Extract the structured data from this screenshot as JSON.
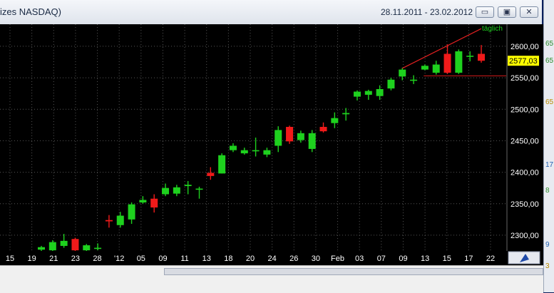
{
  "window": {
    "title": "izes NASDAQ)",
    "date_range": "28.11.2011 - 23.02.2012",
    "buttons": {
      "minimize": "▭",
      "restore": "▣",
      "close": "✕"
    }
  },
  "chart": {
    "interval_label": "täglich",
    "current_price_label": "2577,03",
    "colors": {
      "up": "#1ed11e",
      "down": "#f01a1a",
      "background": "#000000",
      "grid": "#555555",
      "text": "#ffffff",
      "price_tag": "#ffff00"
    },
    "x_tick_labels": [
      "15",
      "19",
      "21",
      "23",
      "28",
      "'12",
      "05",
      "09",
      "11",
      "13",
      "18",
      "20",
      "24",
      "26",
      "30",
      "Feb",
      "03",
      "07",
      "09",
      "13",
      "15",
      "17",
      "22"
    ],
    "y_tick_labels": [
      "2300,00",
      "2350,00",
      "2400,00",
      "2450,00",
      "2500,00",
      "2550,00",
      "2600,00"
    ]
  },
  "right_panel": {
    "labels": [
      "65",
      "65",
      "65",
      "17",
      "8",
      "9",
      "3"
    ]
  },
  "chart_data": {
    "type": "candlestick",
    "x_axis": "date (Nov 2011 - Feb 2012)",
    "ylim": [
      2275,
      2635
    ],
    "candles": [
      {
        "o": 2277,
        "h": 2283,
        "l": 2272,
        "c": 2281
      },
      {
        "o": 2276,
        "h": 2292,
        "l": 2275,
        "c": 2289
      },
      {
        "o": 2283,
        "h": 2302,
        "l": 2280,
        "c": 2291
      },
      {
        "o": 2294,
        "h": 2296,
        "l": 2273,
        "c": 2276
      },
      {
        "o": 2276,
        "h": 2286,
        "l": 2274,
        "c": 2284
      },
      {
        "o": 2280,
        "h": 2287,
        "l": 2276,
        "c": 2280
      },
      {
        "o": 2324,
        "h": 2332,
        "l": 2312,
        "c": 2322
      },
      {
        "o": 2316,
        "h": 2337,
        "l": 2312,
        "c": 2331
      },
      {
        "o": 2325,
        "h": 2352,
        "l": 2318,
        "c": 2349
      },
      {
        "o": 2352,
        "h": 2362,
        "l": 2350,
        "c": 2356
      },
      {
        "o": 2358,
        "h": 2365,
        "l": 2336,
        "c": 2344
      },
      {
        "o": 2365,
        "h": 2382,
        "l": 2362,
        "c": 2375
      },
      {
        "o": 2366,
        "h": 2380,
        "l": 2362,
        "c": 2376
      },
      {
        "o": 2378,
        "h": 2386,
        "l": 2365,
        "c": 2380
      },
      {
        "o": 2374,
        "h": 2377,
        "l": 2358,
        "c": 2374
      },
      {
        "o": 2399,
        "h": 2408,
        "l": 2388,
        "c": 2394
      },
      {
        "o": 2398,
        "h": 2430,
        "l": 2398,
        "c": 2427
      },
      {
        "o": 2435,
        "h": 2446,
        "l": 2432,
        "c": 2442
      },
      {
        "o": 2430,
        "h": 2439,
        "l": 2428,
        "c": 2435
      },
      {
        "o": 2435,
        "h": 2455,
        "l": 2425,
        "c": 2435
      },
      {
        "o": 2428,
        "h": 2439,
        "l": 2424,
        "c": 2435
      },
      {
        "o": 2442,
        "h": 2473,
        "l": 2432,
        "c": 2467
      },
      {
        "o": 2472,
        "h": 2474,
        "l": 2445,
        "c": 2449
      },
      {
        "o": 2451,
        "h": 2466,
        "l": 2447,
        "c": 2462
      },
      {
        "o": 2437,
        "h": 2467,
        "l": 2432,
        "c": 2462
      },
      {
        "o": 2472,
        "h": 2479,
        "l": 2463,
        "c": 2465
      },
      {
        "o": 2478,
        "h": 2495,
        "l": 2470,
        "c": 2486
      },
      {
        "o": 2492,
        "h": 2502,
        "l": 2482,
        "c": 2494
      },
      {
        "o": 2520,
        "h": 2530,
        "l": 2514,
        "c": 2528
      },
      {
        "o": 2523,
        "h": 2531,
        "l": 2515,
        "c": 2529
      },
      {
        "o": 2521,
        "h": 2538,
        "l": 2515,
        "c": 2532
      },
      {
        "o": 2533,
        "h": 2550,
        "l": 2530,
        "c": 2547
      },
      {
        "o": 2552,
        "h": 2566,
        "l": 2546,
        "c": 2563
      },
      {
        "o": 2547,
        "h": 2554,
        "l": 2540,
        "c": 2547
      },
      {
        "o": 2563,
        "h": 2571,
        "l": 2562,
        "c": 2569
      },
      {
        "o": 2558,
        "h": 2577,
        "l": 2555,
        "c": 2571
      },
      {
        "o": 2588,
        "h": 2603,
        "l": 2556,
        "c": 2558
      },
      {
        "o": 2558,
        "h": 2595,
        "l": 2556,
        "c": 2592
      },
      {
        "o": 2585,
        "h": 2592,
        "l": 2576,
        "c": 2585
      },
      {
        "o": 2588,
        "h": 2602,
        "l": 2574,
        "c": 2577
      }
    ],
    "trendline": {
      "from": 32,
      "from_y": 2565,
      "to": 39,
      "to_y": 2628
    },
    "support_level": 2553
  }
}
